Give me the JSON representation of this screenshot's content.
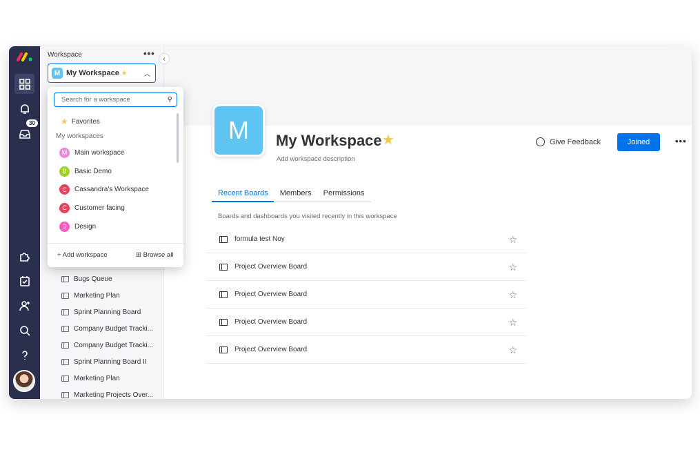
{
  "colors": {
    "rail": "#292f4c",
    "accent": "#0073ea",
    "workspace": "#5fc4f2",
    "star": "#f5c84c"
  },
  "rail": {
    "notification_count": "30"
  },
  "sidebar": {
    "title": "Workspace",
    "selected_workspace": {
      "letter": "M",
      "name": "My Workspace"
    },
    "boards": [
      "Bugs Queue",
      "Marketing Plan",
      "Sprint Planning Board",
      "Company Budget Tracki...",
      "Company Budget Tracki...",
      "Sprint Planning Board II",
      "Marketing Plan",
      "Marketing Projects Over..."
    ]
  },
  "dropdown": {
    "search_placeholder": "Search for a workspace",
    "favorites": "Favorites",
    "section_label": "My workspaces",
    "items": [
      {
        "letter": "M",
        "name": "Main workspace",
        "color": "#e98ad8"
      },
      {
        "letter": "B",
        "name": "Basic Demo",
        "color": "#9cd326"
      },
      {
        "letter": "C",
        "name": "Cassandra's Workspace",
        "color": "#e2445c"
      },
      {
        "letter": "C",
        "name": "Customer facing",
        "color": "#e2445c"
      },
      {
        "letter": "D",
        "name": "Design",
        "color": "#ff5ac4"
      }
    ],
    "add_label": "Add workspace",
    "browse_label": "Browse all"
  },
  "main": {
    "avatar_letter": "M",
    "title": "My Workspace",
    "description": "Add workspace description",
    "feedback_label": "Give Feedback",
    "joined_label": "Joined",
    "tabs": [
      "Recent Boards",
      "Members",
      "Permissions"
    ],
    "subtitle": "Boards and dashboards you visited recently in this workspace",
    "recent_boards": [
      "formula test Noy",
      "Project Overview Board",
      "Project Overview Board",
      "Project Overview Board",
      "Project Overview Board"
    ]
  }
}
